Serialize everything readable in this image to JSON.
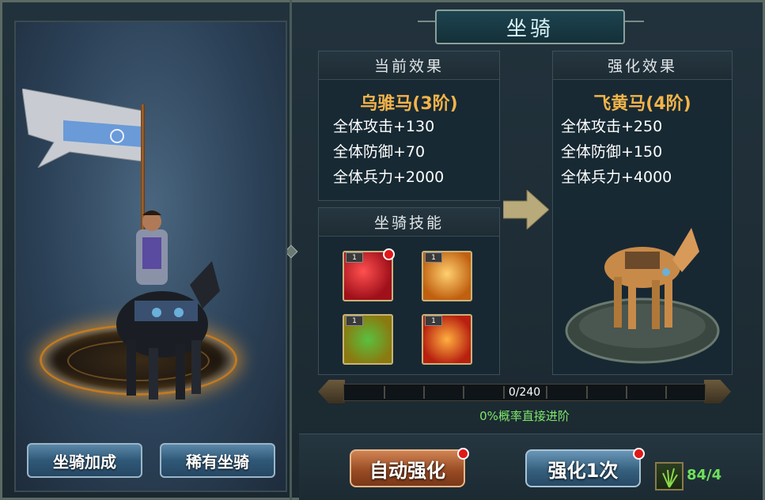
{
  "title": "坐骑",
  "current": {
    "header": "当前效果",
    "mount_name": "乌骓马(3阶)",
    "stats": [
      "全体攻击+130",
      "全体防御+70",
      "全体兵力+2000"
    ]
  },
  "enhanced": {
    "header": "强化效果",
    "mount_name": "飞黄马(4阶)",
    "stats": [
      "全体攻击+250",
      "全体防御+150",
      "全体兵力+4000"
    ]
  },
  "skills": {
    "header": "坐骑技能",
    "items": [
      {
        "level": "1",
        "icon": "red-slash-skill-icon",
        "color": "#c8202a",
        "badge": true
      },
      {
        "level": "1",
        "icon": "golden-warrior-skill-icon",
        "color": "#d8881e",
        "badge": false
      },
      {
        "level": "1",
        "icon": "green-figure-skill-icon",
        "color": "#b89a1a",
        "badge": false
      },
      {
        "level": "1",
        "icon": "fire-burst-skill-icon",
        "color": "#d8421a",
        "badge": false
      }
    ]
  },
  "progress": {
    "text": "0/240",
    "fraction": 0.0,
    "chance_text": "0%概率直接进阶"
  },
  "buttons": {
    "mount_bonus": "坐骑加成",
    "rare_mount": "稀有坐骑",
    "auto_enhance": "自动强化",
    "enhance_once": "强化1次"
  },
  "item": {
    "icon": "grass-material-icon",
    "count": "84/4"
  },
  "colors": {
    "gold": "#f3b44a",
    "green": "#7ee86a",
    "badge_red": "#e01818"
  }
}
